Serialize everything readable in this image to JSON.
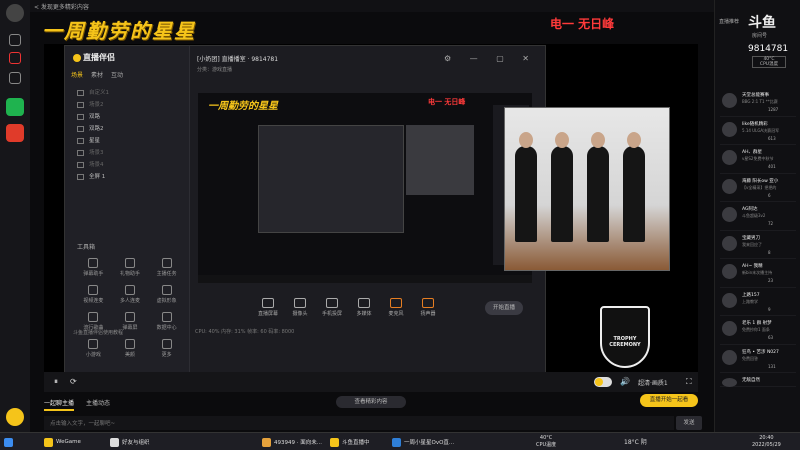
{
  "header": {
    "back_link": "< 发现更多精彩内容",
    "banner_title": "一周勤劳的星星",
    "banner_right": "电一  无日峰"
  },
  "capture_window": {
    "logo": "直播伴侣",
    "tabs": [
      "场景",
      "素材",
      "互动"
    ],
    "scenes": [
      "自定义1",
      "场景2",
      "双路",
      "双路2",
      "星星",
      "场景3",
      "场景4",
      "全屏 1"
    ],
    "tools_title": "工具箱",
    "tools": [
      "弹幕助手",
      "礼物助手",
      "主播任务",
      "视频连麦",
      "多人连麦",
      "虚拟形象",
      "流行歌曲",
      "弹幕屏",
      "数据中心",
      "小游戏",
      "美颜",
      "更多"
    ],
    "footer": "斗鱼直播伴侣使用教程",
    "room_name": "[小奶团] 直播播室",
    "room_sub": "分类：游戏直播",
    "room_id": "9814781",
    "preview_banner": "一周勤劳的星星",
    "preview_red": "电一  无日峰",
    "controls": [
      "直播屏幕",
      "摄像头",
      "手机投屏",
      "多媒体",
      "麦克风",
      "扬声器"
    ],
    "live_button": "开始直播",
    "stats": "CPU: 40%   内存: 31%   帧率: 60   码率: 8000"
  },
  "photo_caption": "TROPHY CEREMONY",
  "player": {
    "play_icon": "⏸",
    "refresh_icon": "⟳",
    "quality": "超清·画质1",
    "volume_icon": "🔊"
  },
  "below": {
    "tabs": [
      "一起聊主播",
      "主播动态"
    ],
    "more_button": "查看精彩内容",
    "follow_button": "直播开始一起看",
    "chat_placeholder": "点击输入文字，一起聊吧~",
    "send_button": "发送"
  },
  "sidebar": {
    "head": "直播推荐",
    "logo": "斗鱼",
    "room_tag": "房间号",
    "room_number": "9814781",
    "cpu_temp": "40°C",
    "cpu_label": "CPU温度",
    "items": [
      {
        "name": "天堂总能赛事",
        "sub": "BBG 2:1 T1 **比赛",
        "count": "1287"
      },
      {
        "name": "like随机精彩",
        "sub": "5.14 ULGA决赛冠军",
        "count": "613"
      },
      {
        "name": "AH、群星",
        "sub": "v星S2免费中秋节",
        "count": "401"
      },
      {
        "name": "海藤 阳长ow 亚小",
        "sub": "【v全精采】把把的",
        "count": "6"
      },
      {
        "name": "AG阿达",
        "sub": "斗鱼超级3v2",
        "count": "72"
      },
      {
        "name": "宝藏男刀",
        "sub": "我来回应了",
        "count": "8"
      },
      {
        "name": "AH~ 我精",
        "sub": "新bin末次播主持",
        "count": "23"
      },
      {
        "name": "上路157",
        "sub": "上路教学",
        "count": "9"
      },
      {
        "name": "老乐 1 群 射梦",
        "sub": "免费抄你1 面条",
        "count": "63"
      },
      {
        "name": "狂鸟 • 苦涉 N027",
        "sub": "免费回答",
        "count": "131"
      },
      {
        "name": "无敌自然",
        "sub": "",
        "count": ""
      }
    ]
  },
  "taskbar": {
    "items": [
      "WeGame",
      "好友与组织",
      "493949 · 面向未...",
      "斗鱼直播中",
      "一周小星星OvO直..."
    ],
    "cpu_temp": "40°C",
    "cpu_label": "CPU温度",
    "weather": "18°C 阴",
    "time": "20:40",
    "date": "2022/05/29"
  }
}
